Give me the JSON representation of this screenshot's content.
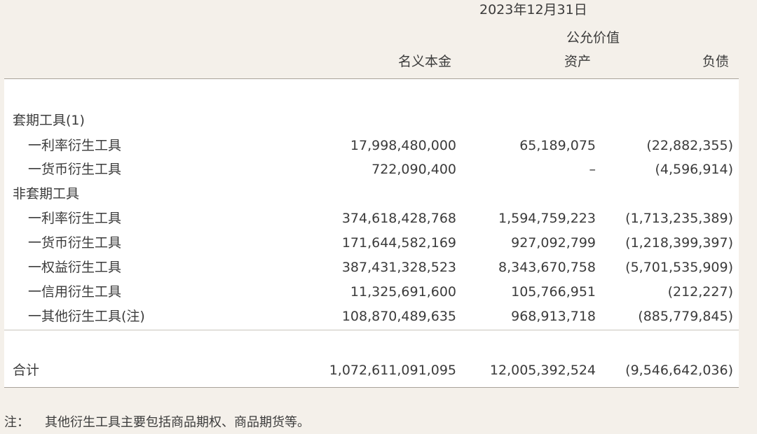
{
  "header": {
    "date": "2023年12月31日",
    "fair_value": "公允价值",
    "col_notional": "名义本金",
    "col_asset": "资产",
    "col_liability": "负债"
  },
  "rows": [
    {
      "label": "套期工具(1)",
      "notional": "",
      "asset": "",
      "liability": ""
    },
    {
      "label": "一利率衍生工具",
      "notional": "17,998,480,000",
      "asset": "65,189,075",
      "liability": "(22,882,355)"
    },
    {
      "label": "一货币衍生工具",
      "notional": "722,090,400",
      "asset": "–",
      "liability": "(4,596,914)"
    },
    {
      "label": "非套期工具",
      "notional": "",
      "asset": "",
      "liability": ""
    },
    {
      "label": "一利率衍生工具",
      "notional": "374,618,428,768",
      "asset": "1,594,759,223",
      "liability": "(1,713,235,389)"
    },
    {
      "label": "一货币衍生工具",
      "notional": "171,644,582,169",
      "asset": "927,092,799",
      "liability": "(1,218,399,397)"
    },
    {
      "label": "一权益衍生工具",
      "notional": "387,431,328,523",
      "asset": "8,343,670,758",
      "liability": "(5,701,535,909)"
    },
    {
      "label": "一信用衍生工具",
      "notional": "11,325,691,600",
      "asset": "105,766,951",
      "liability": "(212,227)"
    },
    {
      "label": "一其他衍生工具(注)",
      "notional": "108,870,489,635",
      "asset": "968,913,718",
      "liability": "(885,779,845)"
    }
  ],
  "total": {
    "label": "合计",
    "notional": "1,072,611,091,095",
    "asset": "12,005,392,524",
    "liability": "(9,546,642,036)"
  },
  "note": {
    "label": "注：",
    "text": "其他衍生工具主要包括商品期权、商品期货等。"
  }
}
